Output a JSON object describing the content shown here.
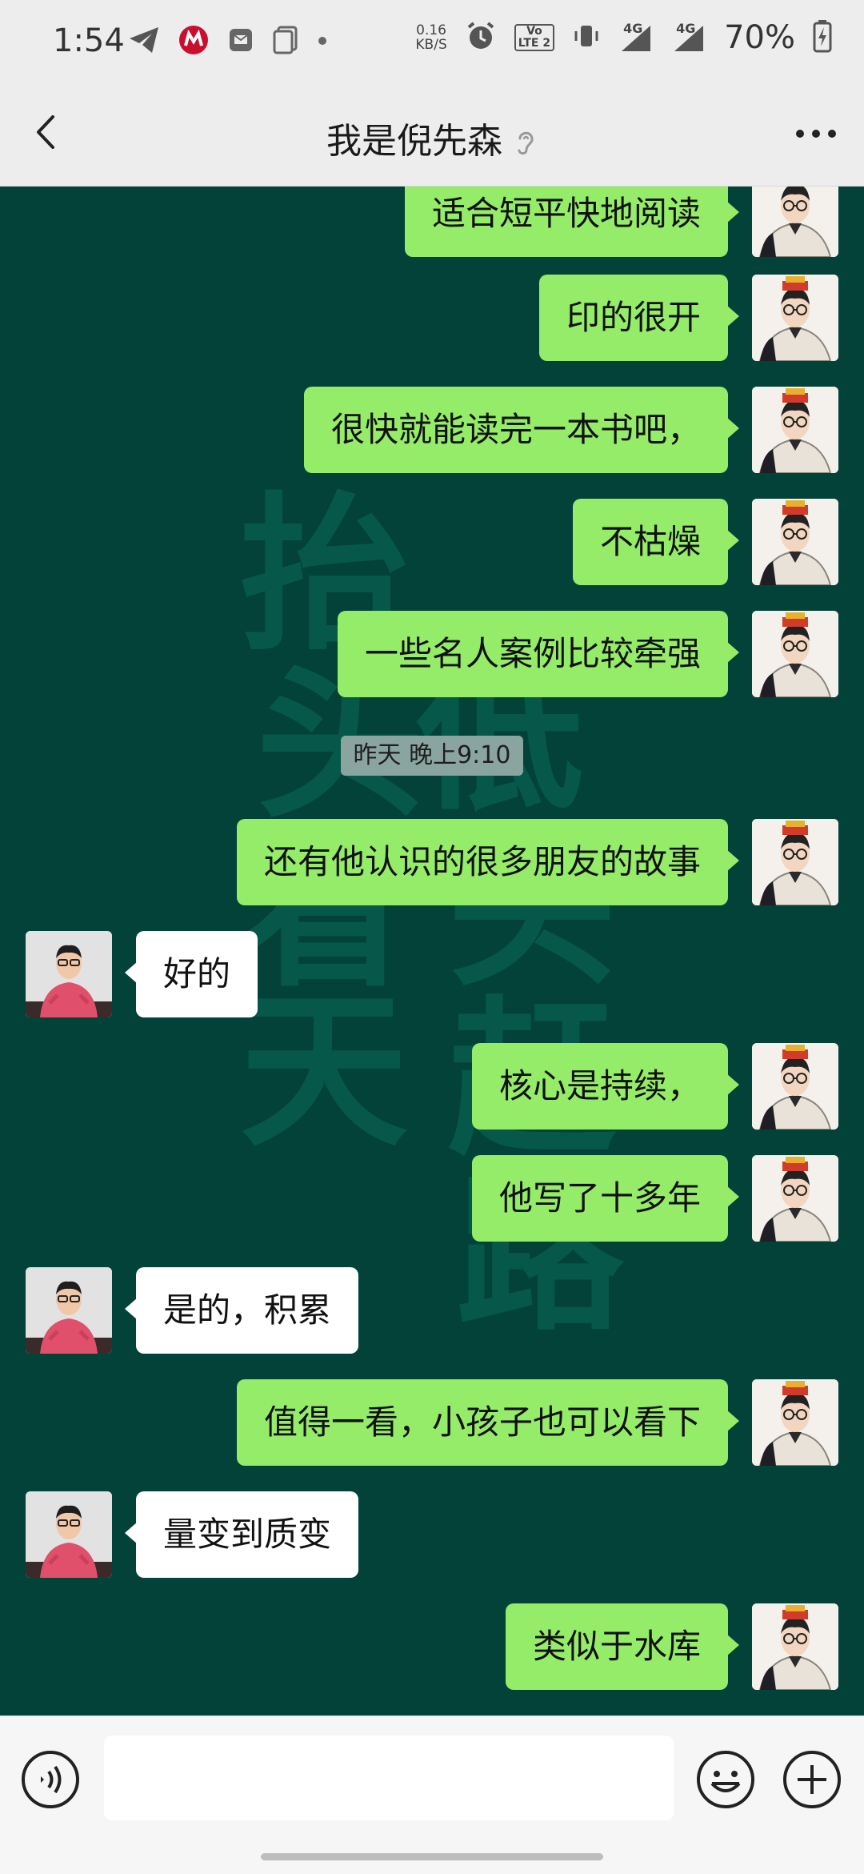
{
  "status_bar": {
    "time": "1:54",
    "net_speed_value": "0.16",
    "net_speed_unit": "KB/S",
    "signal_1": "4G",
    "signal_2": "4G",
    "volte_1": "Vo",
    "volte_2": "LTE 2",
    "battery": "70%"
  },
  "header": {
    "title": "我是倪先森",
    "icons": [
      "back-icon",
      "ear-icon",
      "more-icon"
    ]
  },
  "watermark": [
    "抬",
    "头",
    "看",
    "天",
    "低",
    "头",
    "赶",
    "路"
  ],
  "timestamp": "昨天 晚上9:10",
  "messages": [
    {
      "side": "me",
      "text": "适合短平快地阅读"
    },
    {
      "side": "me",
      "text": "印的很开"
    },
    {
      "side": "me",
      "text": "很快就能读完一本书吧，"
    },
    {
      "side": "me",
      "text": "不枯燥"
    },
    {
      "side": "me",
      "text": "一些名人案例比较牵强"
    },
    {
      "side": "me",
      "text": "还有他认识的很多朋友的故事"
    },
    {
      "side": "them",
      "text": "好的"
    },
    {
      "side": "me",
      "text": "核心是持续，"
    },
    {
      "side": "me",
      "text": "他写了十多年"
    },
    {
      "side": "them",
      "text": "是的，积累"
    },
    {
      "side": "me",
      "text": "值得一看，小孩子也可以看下"
    },
    {
      "side": "them",
      "text": "量变到质变"
    },
    {
      "side": "me",
      "text": "类似于水库"
    }
  ],
  "input_bar": {
    "icons": [
      "voice-icon",
      "emoji-icon",
      "plus-icon"
    ],
    "text": ""
  },
  "colors": {
    "chat_bg": "#024238",
    "my_bubble": "#95ec69",
    "their_bubble": "#ffffff"
  }
}
